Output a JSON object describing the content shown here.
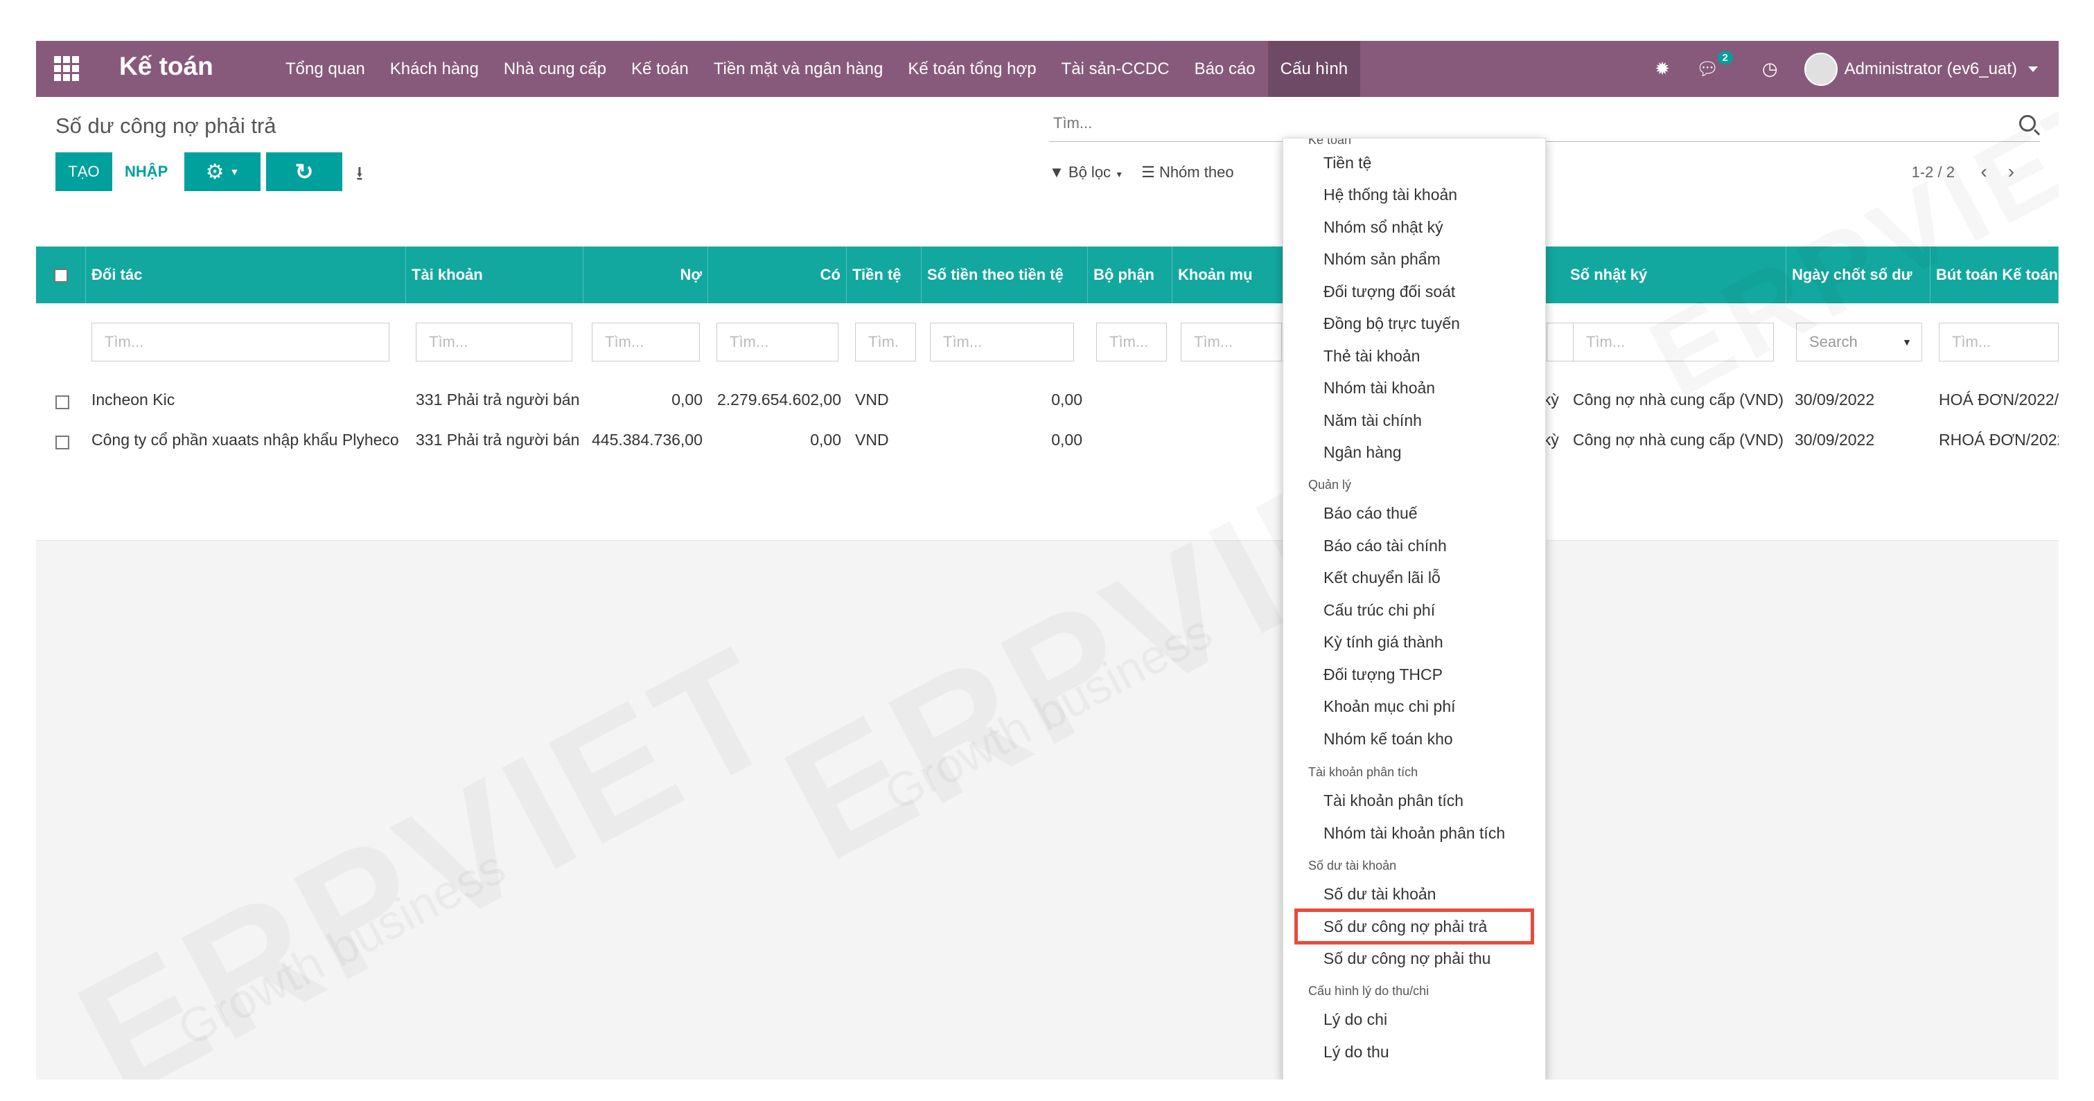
{
  "navbar": {
    "brand": "Kế toán",
    "menu": [
      "Tổng quan",
      "Khách hàng",
      "Nhà cung cấp",
      "Kế toán",
      "Tiền mặt và ngân hàng",
      "Kế toán tổng hợp",
      "Tài sản-CCDC",
      "Báo cáo",
      "Cấu hình"
    ],
    "active_menu": "Cấu hình",
    "messages_badge": "2",
    "user": "Administrator (ev6_uat)"
  },
  "control": {
    "breadcrumb": "Số dư công nợ phải trả",
    "create_label": "TẠO",
    "import_label": "NHẬP",
    "search_placeholder": "Tìm...",
    "filter_label": "Bộ lọc",
    "group_label": "Nhóm theo",
    "pager": "1-2 / 2"
  },
  "table": {
    "headers": [
      "Đối tác",
      "Tài khoản",
      "Nợ",
      "Có",
      "Tiền tệ",
      "Số tiền theo tiền tệ",
      "Bộ phận",
      "Khoản mụ",
      "Số nhật ký",
      "Ngày chốt số dư",
      "Bút toán Kế toán"
    ],
    "filter_placeholders": [
      "Tìm...",
      "Tìm...",
      "Tìm...",
      "Tìm...",
      "Tìm.",
      "Tìm...",
      "Tìm...",
      "Tìm...",
      "Tìm...",
      "Search",
      "Tìm..."
    ],
    "rows": [
      {
        "partner": "Incheon Kic",
        "account": "331 Phải trả người bán",
        "debit": "0,00",
        "credit": "2.279.654.602,00",
        "currency": "VND",
        "amount_currency": "0,00",
        "hidden_col": "đầu kỳ",
        "journal": "Công nợ nhà cung cấp (VND)",
        "date": "30/09/2022",
        "move": "HOÁ ĐƠN/2022/"
      },
      {
        "partner": "Công ty cổ phần xuaats nhập khẩu Plyheco",
        "account": "331 Phải trả người bán",
        "debit": "445.384.736,00",
        "credit": "0,00",
        "currency": "VND",
        "amount_currency": "0,00",
        "hidden_col": "đầu kỳ",
        "journal": "Công nợ nhà cung cấp (VND)",
        "date": "30/09/2022",
        "move": "RHOÁ ĐƠN/2022"
      }
    ]
  },
  "dropdown": {
    "top_header_partial": "Kế toán",
    "groups": [
      {
        "items": [
          "Tiền tệ",
          "Hệ thống tài khoản",
          "Nhóm sổ nhật ký",
          "Nhóm sản phẩm",
          "Đối tượng đối soát",
          "Đồng bộ trực tuyến",
          "Thẻ tài khoản",
          "Nhóm tài khoản",
          "Năm tài chính",
          "Ngân hàng"
        ]
      },
      {
        "header": "Quản lý",
        "items": [
          "Báo cáo thuế",
          "Báo cáo tài chính",
          "Kết chuyển lãi lỗ",
          "Cấu trúc chi phí",
          "Kỳ tính giá thành",
          "Đối tượng THCP",
          "Khoản mục chi phí",
          "Nhóm kế toán kho"
        ]
      },
      {
        "header": "Tài khoản phân tích",
        "items": [
          "Tài khoản phân tích",
          "Nhóm tài khoản phân tích"
        ]
      },
      {
        "header": "Số dư tài khoản",
        "items": [
          "Số dư tài khoản",
          "Số dư công nợ phải trả",
          "Số dư công nợ phải thu"
        ]
      },
      {
        "header": "Cấu hình lý do thu/chi",
        "items": [
          "Lý do chi",
          "Lý do thu"
        ]
      }
    ],
    "highlighted": "Số dư công nợ phải trả"
  },
  "watermark": {
    "text": "ERPVIET",
    "sub": "Growth business"
  }
}
